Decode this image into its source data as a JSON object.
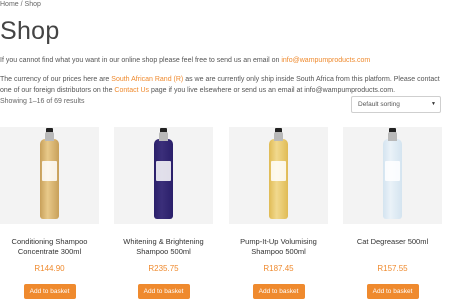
{
  "breadcrumb": {
    "home": "Home",
    "separator": " / ",
    "current": "Shop"
  },
  "page_title": "Shop",
  "intro": {
    "text": "If you cannot find what you want in our online shop please feel free to send us an email on ",
    "email": "info@wampumproducts.com"
  },
  "currency_notice": {
    "part1": "The currency of our prices here are ",
    "currency": "South African Rand (R)",
    "part2": " as we are currently only ship inside South Africa from this platform. Please contact one of our foreign distributors on the ",
    "contact_link": "Contact Us",
    "part3": " page if you live elsewhere or send us an email at info@wampumproducts.com."
  },
  "result_count": "Showing 1–16 of 69 results",
  "sorting": {
    "selected": "Default sorting",
    "icon": "chevron-down-icon"
  },
  "colors": {
    "accent": "#ef8a2e"
  },
  "products": [
    {
      "name": "Conditioning Shampoo Concentrate 300ml",
      "price": "R144.90",
      "button": "Add to basket",
      "bottle_color": "#e8c98a",
      "liquid": "#c8a05a"
    },
    {
      "name": "Whitening & Brightening Shampoo 500ml",
      "price": "R235.75",
      "button": "Add to basket",
      "bottle_color": "#3b2f7a",
      "liquid": "#2a1f6a"
    },
    {
      "name": "Pump-It-Up Volumising Shampoo 500ml",
      "price": "R187.45",
      "button": "Add to basket",
      "bottle_color": "#f1d98e",
      "liquid": "#e0bb55"
    },
    {
      "name": "Cat Degreaser 500ml",
      "price": "R157.55",
      "button": "Add to basket",
      "bottle_color": "#eaf2f8",
      "liquid": "#d4e4f0"
    }
  ]
}
